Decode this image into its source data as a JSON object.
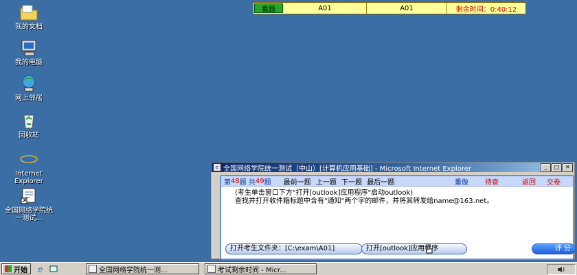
{
  "desktop": {
    "icons": [
      {
        "label": "我的文档",
        "icon": "folder-icon"
      },
      {
        "label": "我的电脑",
        "icon": "computer-icon"
      },
      {
        "label": "网上邻居",
        "icon": "network-icon"
      },
      {
        "label": "回收站",
        "icon": "recycle-bin-icon"
      },
      {
        "label": "Internet Explorer",
        "icon": "ie-icon"
      },
      {
        "label": "全国网络学院统一测试...",
        "icon": "shortcut-icon"
      }
    ]
  },
  "exam_bar": {
    "view_button": "看题",
    "field1": "A01",
    "field2": "A01",
    "timer": "剩余时间：0:40:12"
  },
  "exam_window": {
    "title": "全国网络学院统一测试（中山）[计算机应用基础] - Microsoft Internet Explorer",
    "nav": {
      "q_prefix": "第",
      "q_current": "48",
      "q_mid": "题 共",
      "q_total": "49",
      "q_suffix": "题",
      "links": "最前一题 上一题 下一题 最后一题",
      "redo": "重做",
      "pending": "待查",
      "back": "返回",
      "submit": "交卷"
    },
    "question": {
      "line1": "(考生单击窗口下方\"打开[outlook]应用程序\"启动outlook)",
      "line2": "查找并打开收件箱标题中含有\"通知\"两个字的邮件，并将其转发给name@163.net。"
    },
    "buttons": {
      "open_folder": "打开考生文件夹：[C:\\exam\\A01]",
      "open_app": "打开[outlook]应用程序",
      "score": "评 分"
    }
  },
  "taskbar": {
    "start": "开始",
    "tasks": [
      "全国网络学院统一测...",
      "考试剩余时间 - Micr..."
    ]
  },
  "colors": {
    "desktop": "#3a6ea5",
    "accent_red": "#d00000",
    "title_blue": "#0a246a"
  }
}
